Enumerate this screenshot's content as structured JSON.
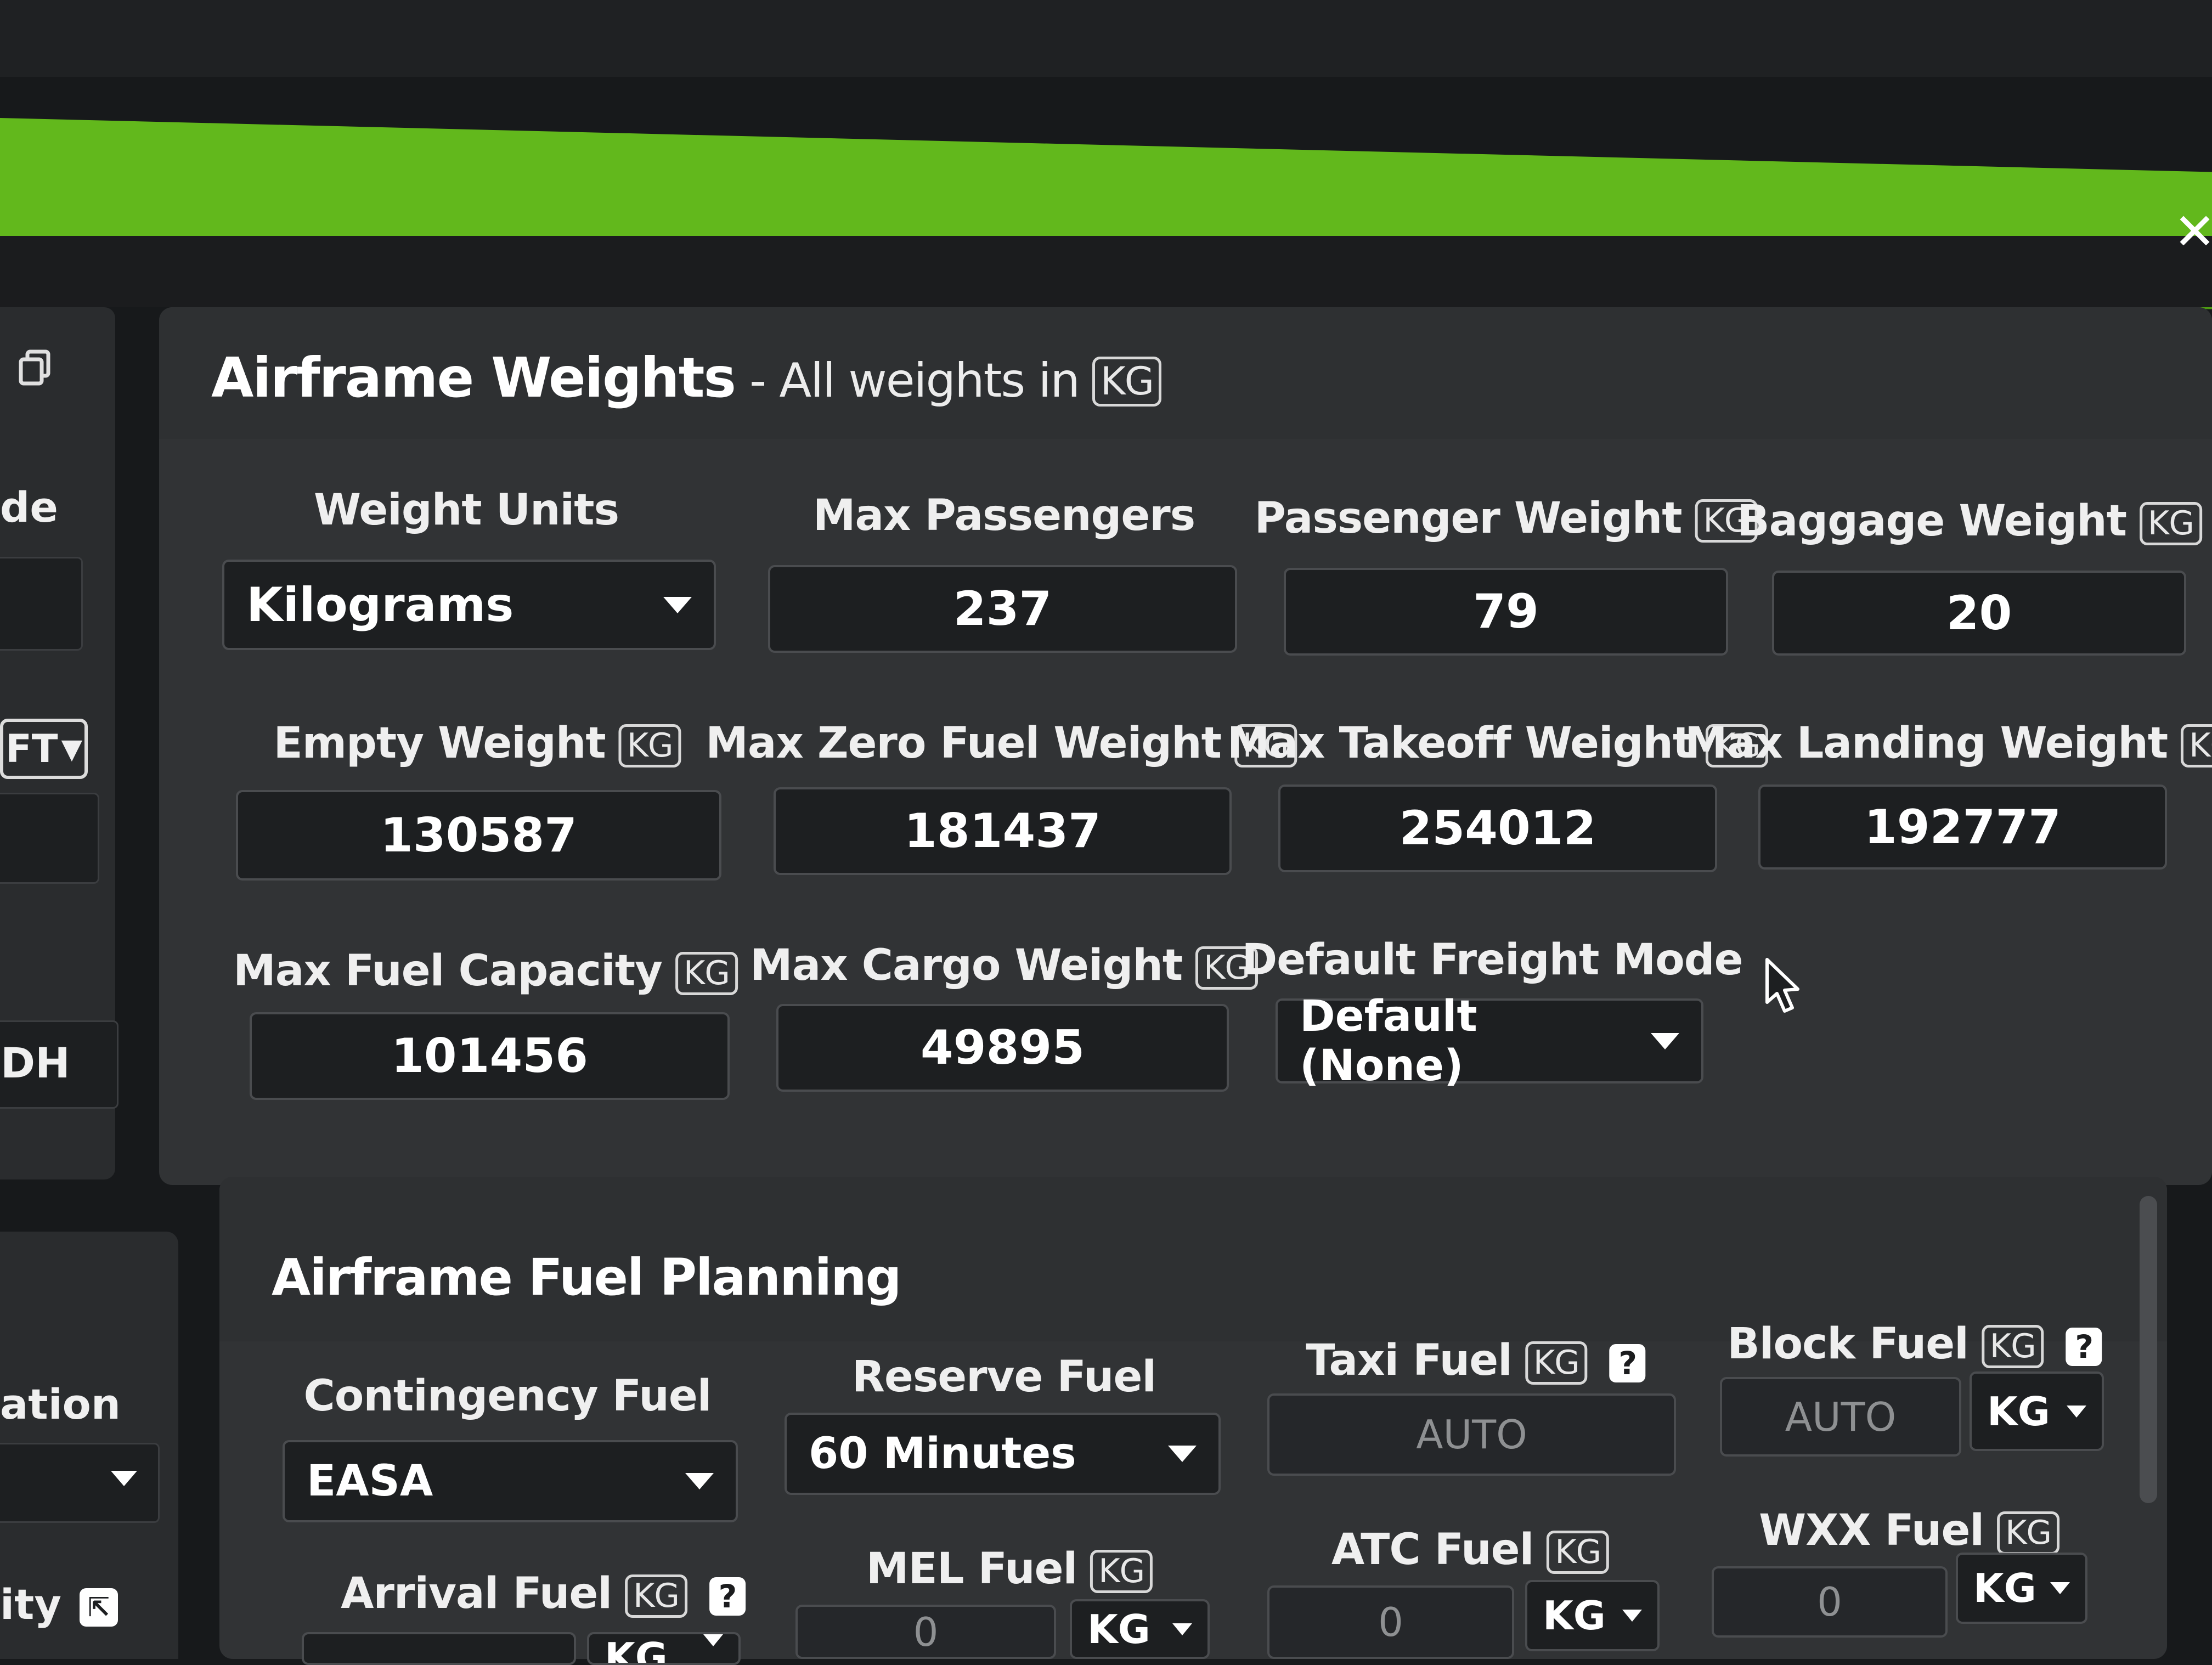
{
  "window": {
    "close_glyph": "✕"
  },
  "sidebar": {
    "item_de": "de",
    "unit_select": "FT",
    "item_dh": "DH",
    "item_ation": "ation",
    "item_ity": "ity",
    "copy_icon": "copy-icon",
    "external_link_icon": "external-link-icon"
  },
  "weights": {
    "title": "Airframe Weights",
    "subtitle": "- All weights in",
    "unit_badge": "KG",
    "fields": {
      "weight_units": {
        "label": "Weight Units",
        "value": "Kilograms"
      },
      "max_passengers": {
        "label": "Max Passengers",
        "value": "237"
      },
      "passenger_weight": {
        "label": "Passenger Weight",
        "badge": "KG",
        "value": "79"
      },
      "baggage_weight": {
        "label": "Baggage Weight",
        "badge": "KG",
        "value": "20"
      },
      "empty_weight": {
        "label": "Empty Weight",
        "badge": "KG",
        "value": "130587"
      },
      "max_zero_fuel_weight": {
        "label": "Max Zero Fuel Weight",
        "badge": "KG",
        "value": "181437"
      },
      "max_takeoff_weight": {
        "label": "Max Takeoff Weight",
        "badge": "KG",
        "value": "254012"
      },
      "max_landing_weight": {
        "label": "Max Landing Weight",
        "badge": "KG",
        "value": "192777"
      },
      "max_fuel_capacity": {
        "label": "Max Fuel Capacity",
        "badge": "KG",
        "value": "101456"
      },
      "max_cargo_weight": {
        "label": "Max Cargo Weight",
        "badge": "KG",
        "value": "49895"
      },
      "default_freight_mode": {
        "label": "Default Freight Mode",
        "value": "Default (None)"
      }
    }
  },
  "fuel": {
    "title": "Airframe Fuel Planning",
    "fields": {
      "contingency_fuel": {
        "label": "Contingency Fuel",
        "value": "EASA"
      },
      "reserve_fuel": {
        "label": "Reserve Fuel",
        "value": "60 Minutes"
      },
      "taxi_fuel": {
        "label": "Taxi Fuel",
        "badge": "KG",
        "help": "?",
        "placeholder": "AUTO"
      },
      "block_fuel": {
        "label": "Block Fuel",
        "badge": "KG",
        "help": "?",
        "placeholder": "AUTO",
        "unit": "KG"
      },
      "arrival_fuel": {
        "label": "Arrival Fuel",
        "badge": "KG",
        "help": "?",
        "unit": "KG"
      },
      "mel_fuel": {
        "label": "MEL Fuel",
        "badge": "KG",
        "placeholder": "0",
        "unit": "KG"
      },
      "atc_fuel": {
        "label": "ATC Fuel",
        "badge": "KG",
        "placeholder": "0",
        "unit": "KG"
      },
      "wxx_fuel": {
        "label": "WXX Fuel",
        "badge": "KG",
        "placeholder": "0",
        "unit": "KG"
      }
    }
  }
}
